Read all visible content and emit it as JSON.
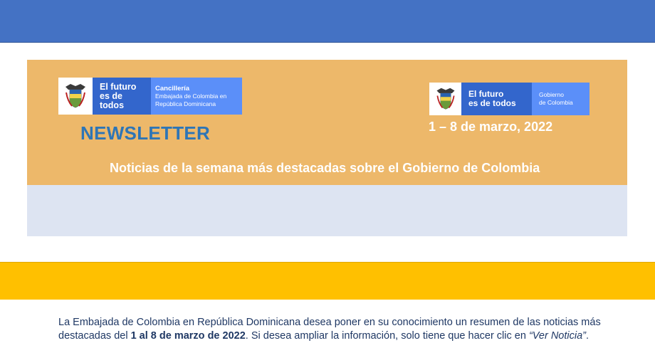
{
  "logos": {
    "left": {
      "slogan_line1": "El futuro",
      "slogan_line2": "es de todos",
      "entity_line1": "Cancillería",
      "entity_line2": "Embajada de Colombia en",
      "entity_line3": "República Dominicana"
    },
    "right": {
      "slogan_line1": "El futuro",
      "slogan_line2": "es de todos",
      "entity_line1": "Gobierno",
      "entity_line2": "de Colombia"
    }
  },
  "newsletter_title": "NEWSLETTER",
  "date_range": "1 – 8 de marzo, 2022",
  "headline": "Noticias de la semana más destacadas sobre el Gobierno de Colombia",
  "intro": {
    "part1": "La Embajada de Colombia en República Dominicana desea poner en su conocimiento un resumen de las noticias más destacadas del ",
    "bold": "1 al 8 de marzo de 2022",
    "part2": ". Si desea ampliar la información, solo tiene que hacer clic en ",
    "italic": "“Ver Noticia”",
    "part3": "."
  },
  "colors": {
    "top_band": "#4472c4",
    "bottom_band": "#ffc000",
    "banner": "#edb86a",
    "intro_bg": "#dde4f2",
    "title": "#2e75b6"
  },
  "icons": [
    "colombia-coat-of-arms-icon"
  ]
}
